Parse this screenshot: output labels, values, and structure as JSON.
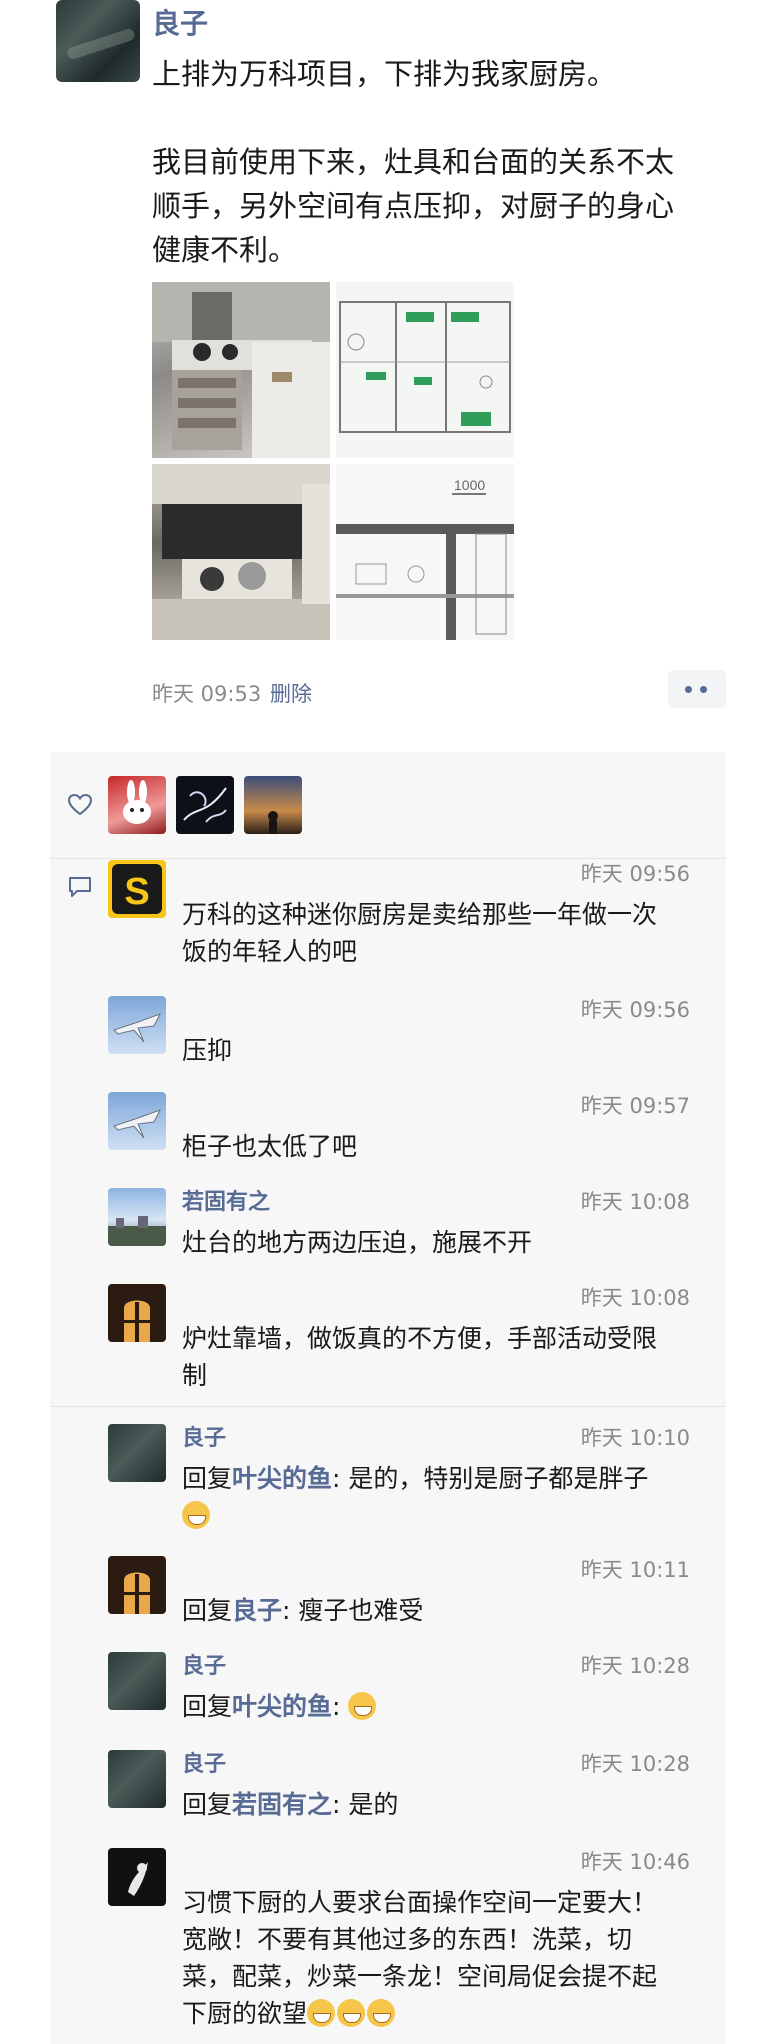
{
  "post": {
    "author": "良子",
    "lines": [
      "上排为万科项目，下排为我家厨房。",
      "",
      "我目前使用下来，灶具和台面的关系不太",
      "顺手，另外空间有点压抑，对厨子的身心",
      "健康不利。"
    ],
    "time": "昨天 09:53",
    "delete_label": "删除",
    "images": [
      "kitchen-photo",
      "floor-plan",
      "kitchen-photo",
      "floor-plan"
    ]
  },
  "likes": {
    "icon": "heart-icon",
    "avatars": [
      "rabbit-avatar",
      "dark-art-avatar",
      "sunset-avatar"
    ]
  },
  "comments": [
    {
      "name": "",
      "time": "昨天 09:56",
      "text": "万科的这种迷你厨房是卖给那些一年做一次饭的年轻人的吧",
      "lines": [
        "万科的这种迷你厨房是卖给那些一年做一次",
        "饭的年轻人的吧"
      ]
    },
    {
      "name": "",
      "time": "昨天 09:56",
      "lines": [
        "压抑"
      ]
    },
    {
      "name": "",
      "time": "昨天 09:57",
      "lines": [
        "柜子也太低了吧"
      ]
    },
    {
      "name": "若固有之",
      "time": "昨天 10:08",
      "lines": [
        "灶台的地方两边压迫，施展不开"
      ]
    },
    {
      "name": "",
      "time": "昨天 10:08",
      "lines": [
        "炉灶靠墙，做饭真的不方便，手部活动受限",
        "制"
      ]
    },
    {
      "name": "良子",
      "time": "昨天 10:10",
      "reply_prefix": "回复",
      "reply_to": "叶尖的鱼",
      "reply_text": ": 是的，特别是厨子都是胖子"
    },
    {
      "name": "",
      "time": "昨天 10:11",
      "reply_prefix": "回复",
      "reply_to": "良子",
      "reply_text": ": 瘦子也难受"
    },
    {
      "name": "良子",
      "time": "昨天 10:28",
      "reply_prefix": "回复",
      "reply_to": "叶尖的鱼",
      "reply_text": ": "
    },
    {
      "name": "良子",
      "time": "昨天 10:28",
      "reply_prefix": "回复",
      "reply_to": "若固有之",
      "reply_text": ": 是的"
    },
    {
      "name": "",
      "time": "昨天 10:46",
      "lines": [
        "习惯下厨的人要求台面操作空间一定要大！",
        "宽敞！不要有其他过多的东西！洗菜，切",
        "菜，配菜，炒菜一条龙！空间局促会提不起",
        "下厨的欲望"
      ]
    }
  ],
  "colors": {
    "link": "#576b95",
    "panel": "#f7f7f7",
    "meta": "#8a8a8a"
  }
}
